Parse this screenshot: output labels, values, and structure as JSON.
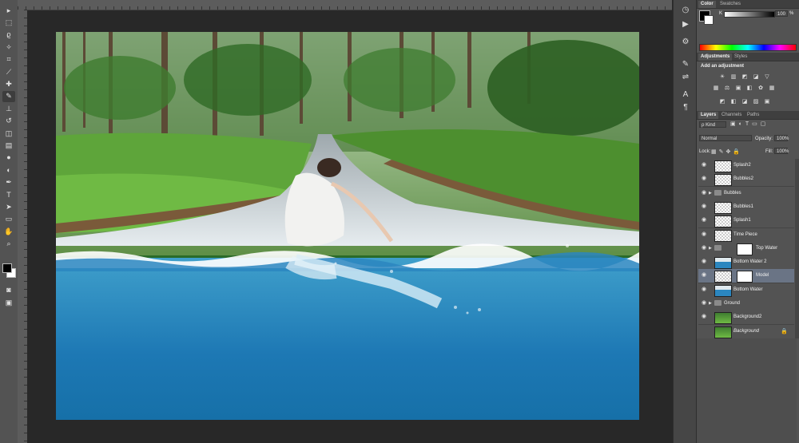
{
  "tools": [
    {
      "name": "move-tool-icon",
      "glyph": "▸"
    },
    {
      "name": "marquee-tool-icon",
      "glyph": "⬚"
    },
    {
      "name": "lasso-tool-icon",
      "glyph": "ϱ"
    },
    {
      "name": "magic-wand-tool-icon",
      "glyph": "✧"
    },
    {
      "name": "crop-tool-icon",
      "glyph": "⌗"
    },
    {
      "name": "eyedropper-tool-icon",
      "glyph": "⟋"
    },
    {
      "name": "healing-brush-tool-icon",
      "glyph": "✚"
    },
    {
      "name": "brush-tool-icon",
      "glyph": "✎"
    },
    {
      "name": "clone-stamp-tool-icon",
      "glyph": "⊥"
    },
    {
      "name": "history-brush-tool-icon",
      "glyph": "↺"
    },
    {
      "name": "eraser-tool-icon",
      "glyph": "◫"
    },
    {
      "name": "gradient-tool-icon",
      "glyph": "▤"
    },
    {
      "name": "blur-tool-icon",
      "glyph": "●"
    },
    {
      "name": "dodge-tool-icon",
      "glyph": "◐"
    },
    {
      "name": "pen-tool-icon",
      "glyph": "✒"
    },
    {
      "name": "type-tool-icon",
      "glyph": "T"
    },
    {
      "name": "path-selection-tool-icon",
      "glyph": "➤"
    },
    {
      "name": "shape-tool-icon",
      "glyph": "▭"
    },
    {
      "name": "hand-tool-icon",
      "glyph": "✋"
    },
    {
      "name": "zoom-tool-icon",
      "glyph": "⌕"
    }
  ],
  "colors": {
    "foreground": "#000000",
    "background": "#ffffff"
  },
  "color_panel": {
    "tabs": [
      "Color",
      "Swatches"
    ],
    "channel_label": "K",
    "value": "100",
    "unit": "%"
  },
  "adjustments_panel": {
    "tabs": [
      "Adjustments",
      "Styles"
    ],
    "heading": "Add an adjustment",
    "icons_row1": [
      "☀",
      "▥",
      "◩",
      "◪",
      "▽"
    ],
    "icons_row2": [
      "▦",
      "⚖",
      "▣",
      "◧",
      "✿",
      "▦"
    ],
    "icons_row3": [
      "◩",
      "◧",
      "◪",
      "▨",
      "▣"
    ]
  },
  "layers_panel": {
    "tabs": [
      "Layers",
      "Channels",
      "Paths"
    ],
    "filter_label": "ρ Kind",
    "blend_mode": "Normal",
    "opacity_label": "Opacity:",
    "opacity_value": "100%",
    "lock_label": "Lock:",
    "fill_label": "Fill:",
    "fill_value": "100%",
    "layers": [
      {
        "name": "Splash2",
        "type": "layer",
        "visible": true
      },
      {
        "name": "Bubbles2",
        "type": "layer",
        "visible": true
      },
      {
        "name": "Bubbles",
        "type": "group",
        "visible": true
      },
      {
        "name": "Bubbles1",
        "type": "layer",
        "visible": true
      },
      {
        "name": "Splash1",
        "type": "layer",
        "visible": true
      },
      {
        "name": "Time Piece",
        "type": "layer",
        "visible": true
      },
      {
        "name": "Top Water",
        "type": "group-mask",
        "visible": true
      },
      {
        "name": "Bottom Water 2",
        "type": "layer",
        "visible": true
      },
      {
        "name": "Model",
        "type": "masked",
        "visible": true,
        "selected": true
      },
      {
        "name": "Bottom Water",
        "type": "layer",
        "visible": true
      },
      {
        "name": "Ground",
        "type": "group",
        "visible": true
      },
      {
        "name": "Background2",
        "type": "layer",
        "visible": true
      },
      {
        "name": "Background",
        "type": "background",
        "visible": false,
        "locked": true
      }
    ]
  }
}
